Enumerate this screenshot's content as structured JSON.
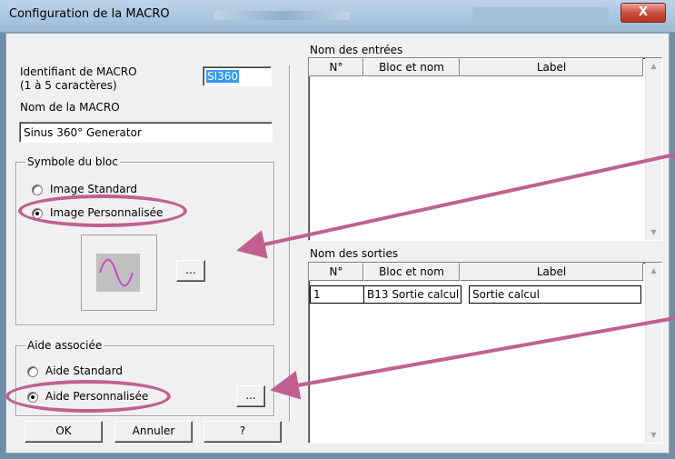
{
  "window": {
    "title": "Configuration de la MACRO",
    "close_label": "X"
  },
  "left": {
    "id_label_line1": "Identifiant de MACRO",
    "id_label_line2": "(1 à 5 caractères)",
    "id_value": "SI360",
    "name_label": "Nom de la MACRO",
    "name_value": "Sinus 360° Generator",
    "symbol_group": {
      "legend": "Symbole du bloc",
      "options": [
        {
          "label": "Image Standard",
          "selected": false
        },
        {
          "label": "Image Personnalisée",
          "selected": true
        }
      ],
      "browse_label": "..."
    },
    "help_group": {
      "legend": "Aide associée",
      "options": [
        {
          "label": "Aide Standard",
          "selected": false
        },
        {
          "label": "Aide Personnalisée",
          "selected": true
        }
      ],
      "browse_label": "..."
    },
    "buttons": {
      "ok": "OK",
      "cancel": "Annuler",
      "help": "?"
    }
  },
  "inputs": {
    "title": "Nom des entrées",
    "columns": [
      "N°",
      "Bloc et nom",
      "Label"
    ],
    "rows": []
  },
  "outputs": {
    "title": "Nom des sorties",
    "columns": [
      "N°",
      "Bloc et nom",
      "Label"
    ],
    "rows": [
      {
        "num": "1",
        "block": "B13 Sortie calcul",
        "label": "Sortie calcul"
      }
    ]
  },
  "colors": {
    "annotation": "#c06090",
    "selection": "#3399ff",
    "preview_bg": "#c0c0c0",
    "wave": "#cc44cc"
  }
}
